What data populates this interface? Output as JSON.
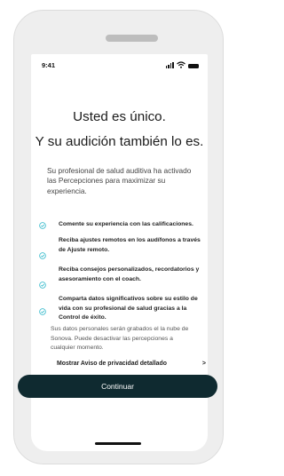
{
  "status_bar": {
    "time": "9:41",
    "icons": [
      "signal-icon",
      "wifi-icon",
      "battery-icon"
    ]
  },
  "title_line1": "Usted es único.",
  "title_line2": "Y su audición también lo es.",
  "intro": "Su profesional de salud auditiva ha activado las Percepciones para maximizar su experiencia.",
  "features": [
    "Comente su experiencia con las calificaciones.",
    "Reciba ajustes remotos en los audífonos a través de Ajuste remoto.",
    "Reciba consejos personalizados, recordatorios y asesoramiento con el coach.",
    "Comparta datos significativos sobre su estilo de vida con su profesional de salud gracias a la Control de éxito."
  ],
  "privacy_text": "Sus datos personales serán grabados el la nube de Sonova. Puede desactivar las percepciones a cualquier momento.",
  "privacy_link": "Mostrar Aviso de privacidad detallado",
  "privacy_chevron": ">",
  "continue_label": "Continuar",
  "colors": {
    "accent": "#2bb6c9",
    "button": "#0f2a30",
    "frame": "#eeeeee"
  }
}
